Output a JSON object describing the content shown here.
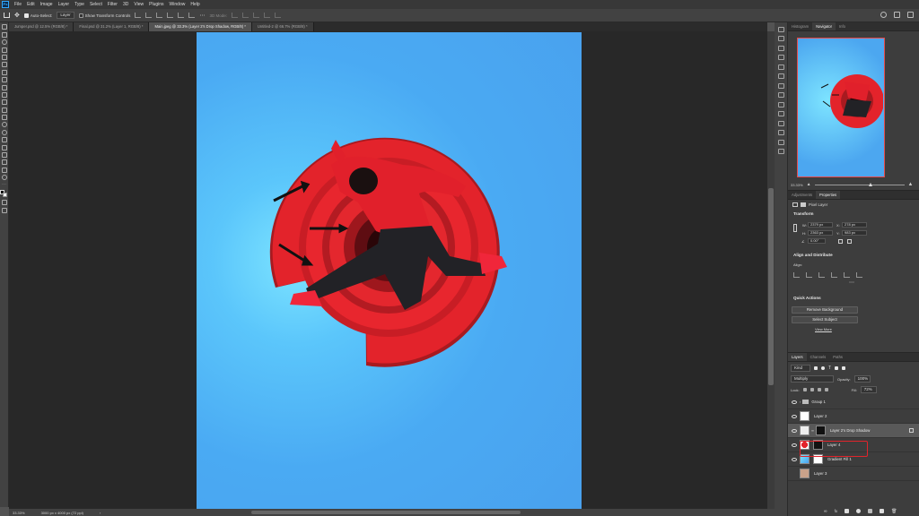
{
  "menu": {
    "logo": "Ps",
    "items": [
      "File",
      "Edit",
      "Image",
      "Layer",
      "Type",
      "Select",
      "Filter",
      "3D",
      "View",
      "Plugins",
      "Window",
      "Help"
    ]
  },
  "options": {
    "auto_select_label": "Auto-Select:",
    "auto_select_target": "Layer",
    "transform_controls_label": "Show Transform Controls",
    "mode_3d_label": "3D Mode:"
  },
  "tabs": [
    {
      "label": "Jumper.psd @ 12.5% (RGB/8) *",
      "active": false
    },
    {
      "label": "Final.psd @ 31.2% (Layer 1, RGB/8) *",
      "active": false
    },
    {
      "label": "Main.jpeg @ 33.3% (Layer 2's Drop Shadow, RGB/8) *",
      "active": true
    },
    {
      "label": "Untitled-2 @ 66.7% (RGB/8) *",
      "active": false
    }
  ],
  "status": {
    "zoom": "33.33%",
    "doc_size": "3000 px x 4000 px (72 ppi)"
  },
  "navigator": {
    "tabs": [
      "Histogram",
      "Navigator",
      "Info"
    ],
    "active_tab": "Navigator",
    "zoom": "33.33%"
  },
  "properties": {
    "tabs": [
      "Adjustments",
      "Properties"
    ],
    "active_tab": "Properties",
    "kind_label": "Pixel Layer",
    "transform_title": "Transform",
    "w_label": "W:",
    "w_value": "2379 px",
    "h_label": "H:",
    "h_value": "2363 px",
    "x_label": "X:",
    "x_value": "278 px",
    "y_label": "Y:",
    "y_value": "983 px",
    "angle_value": "0.00°",
    "align_title": "Align and Distribute",
    "align_label": "Align:",
    "quick_title": "Quick Actions",
    "remove_bg": "Remove Background",
    "select_subject": "Select Subject",
    "view_more": "View More"
  },
  "layers": {
    "tabs": [
      "Layers",
      "Channels",
      "Paths"
    ],
    "active_tab": "Layers",
    "filter_kind": "Kind",
    "blend_mode": "Multiply",
    "opacity_label": "Opacity:",
    "opacity_value": "100%",
    "lock_label": "Lock:",
    "fill_label": "Fill:",
    "fill_value": "72%",
    "rows": [
      {
        "name": "Group 1",
        "selected": false
      },
      {
        "name": "Layer 2",
        "selected": false
      },
      {
        "name": "Layer 2's Drop Shadow",
        "selected": true
      },
      {
        "name": "Layer 4",
        "selected": false
      },
      {
        "name": "Gradient Fill 1",
        "selected": false
      },
      {
        "name": "Layer 3",
        "selected": false
      }
    ]
  },
  "colors": {
    "accent_blue": "#31a8ff",
    "canvas_bg": "#49a1ee",
    "red_circle": "#e0242b",
    "highlight_box": "#e0242b"
  }
}
